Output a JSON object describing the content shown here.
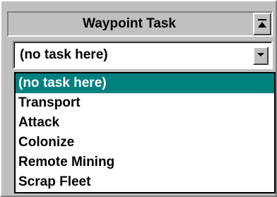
{
  "window": {
    "title": "Waypoint Task"
  },
  "task_select": {
    "selected": "(no task here)",
    "options": [
      "(no task here)",
      "Transport",
      "Attack",
      "Colonize",
      "Remote Mining",
      "Scrap Fleet"
    ],
    "highlighted_index": 0
  },
  "icons": {
    "collapse": "collapse-up-icon",
    "dropdown": "chevron-down-icon"
  },
  "colors": {
    "highlight": "#008080",
    "face": "#c0c0c0"
  }
}
